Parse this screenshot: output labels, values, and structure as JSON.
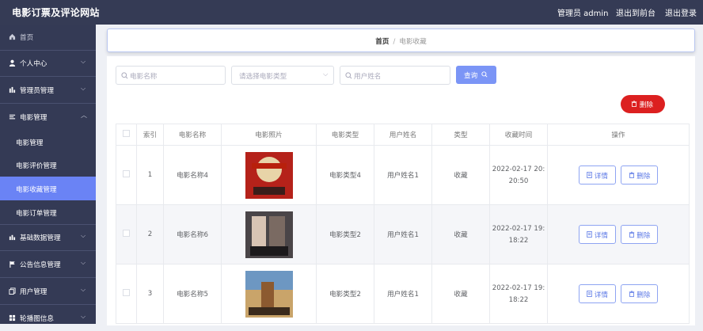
{
  "app": {
    "title": "电影订票及评论网站",
    "admin_label": "管理员 admin",
    "front_link": "退出到前台",
    "logout": "退出登录"
  },
  "sidebar": {
    "home": "首页",
    "menus": [
      {
        "label": "个人中心",
        "icon": "user-icon"
      },
      {
        "label": "管理员管理",
        "icon": "chart-icon"
      },
      {
        "label": "电影管理",
        "icon": "list-icon"
      }
    ],
    "submenus": [
      "电影管理",
      "电影评价管理",
      "电影收藏管理",
      "电影订单管理"
    ],
    "menus2": [
      {
        "label": "基础数据管理",
        "icon": "bars-icon"
      },
      {
        "label": "公告信息管理",
        "icon": "flag-icon"
      },
      {
        "label": "用户管理",
        "icon": "copy-icon"
      },
      {
        "label": "轮播图信息",
        "icon": "grid-icon"
      }
    ],
    "active_color": "#6a83f5"
  },
  "breadcrumb": {
    "home": "首页",
    "sep": "/",
    "current": "电影收藏"
  },
  "filters": {
    "movie_name_ph": "电影名称",
    "type_ph": "请选择电影类型",
    "user_name_ph": "用户姓名",
    "query_btn": "查询",
    "delete_btn": "删除"
  },
  "table": {
    "headers": [
      "索引",
      "电影名称",
      "电影照片",
      "电影类型",
      "用户姓名",
      "类型",
      "收藏时间",
      "操作"
    ],
    "rows": [
      {
        "index": "1",
        "name": "电影名称4",
        "type": "电影类型4",
        "user": "用户姓名1",
        "kind": "收藏",
        "time1": "2022-02-17 20:",
        "time2": "20:50"
      },
      {
        "index": "2",
        "name": "电影名称6",
        "type": "电影类型2",
        "user": "用户姓名1",
        "kind": "收藏",
        "time1": "2022-02-17 19:",
        "time2": "18:22"
      },
      {
        "index": "3",
        "name": "电影名称5",
        "type": "电影类型2",
        "user": "用户姓名1",
        "kind": "收藏",
        "time1": "2022-02-17 19:",
        "time2": "18:22"
      }
    ],
    "detail_btn": "详情",
    "delete_btn": "删除"
  }
}
